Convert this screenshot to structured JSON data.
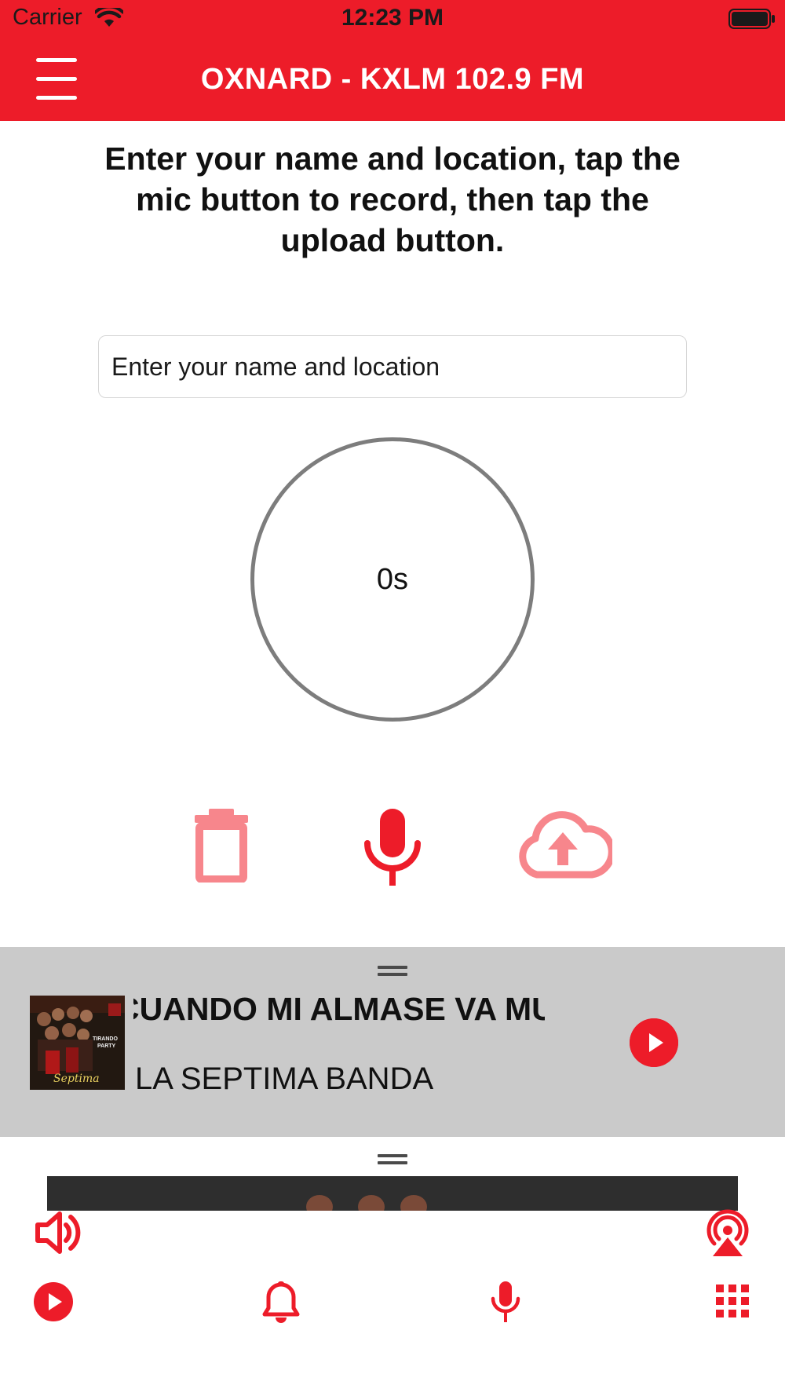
{
  "status_bar": {
    "carrier": "Carrier",
    "time": "12:23 PM",
    "wifi_icon": "wifi-icon",
    "battery_icon": "battery-icon"
  },
  "nav": {
    "menu_icon": "hamburger-menu-icon",
    "title": "OXNARD - KXLM 102.9 FM"
  },
  "recorder": {
    "instructions": "Enter your name and location, tap the mic button to record, then tap the upload button.",
    "name_input": {
      "placeholder": "Enter your name and location",
      "value": ""
    },
    "timer": "0s",
    "actions": [
      {
        "icon": "trash-icon",
        "color": "#f7868c"
      },
      {
        "icon": "microphone-icon",
        "color": "#ed1c29"
      },
      {
        "icon": "cloud-upload-icon",
        "color": "#f7868c"
      }
    ]
  },
  "now_playing": {
    "song_title": "CUANDO MI ALMASE VA MURIENDO",
    "artist": "LA SEPTIMA BANDA",
    "album_art_text": [
      "TIRANDO",
      "PARTY"
    ],
    "play_icon": "play-circle-icon"
  },
  "player_controls": {
    "volume_icon": "volume-icon",
    "airplay_icon": "airplay-icon"
  },
  "tab_bar": [
    {
      "icon": "play-circle-icon"
    },
    {
      "icon": "bell-icon"
    },
    {
      "icon": "microphone-icon"
    },
    {
      "icon": "grid-menu-icon"
    }
  ],
  "colors": {
    "accent": "#ed1c29",
    "accent_light": "#f7868c",
    "player_background": "#cacaca",
    "circle_border": "#7d7d7d"
  }
}
